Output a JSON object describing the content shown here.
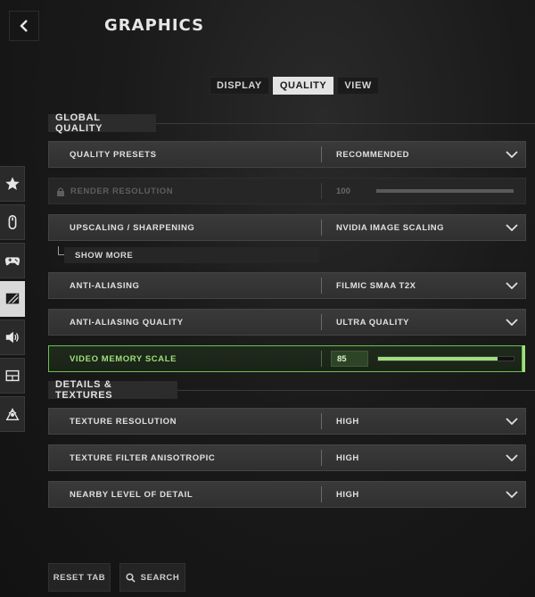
{
  "header": {
    "title": "GRAPHICS",
    "back_icon": "chevron-left-icon"
  },
  "tabs": [
    {
      "label": "DISPLAY",
      "active": false
    },
    {
      "label": "QUALITY",
      "active": true
    },
    {
      "label": "VIEW",
      "active": false
    }
  ],
  "side_nav": [
    {
      "icon": "star-icon",
      "active": false
    },
    {
      "icon": "mouse-icon",
      "active": false
    },
    {
      "icon": "gamepad-icon",
      "active": false
    },
    {
      "icon": "graphics-icon",
      "active": true
    },
    {
      "icon": "speaker-icon",
      "active": false
    },
    {
      "icon": "interface-icon",
      "active": false
    },
    {
      "icon": "network-icon",
      "active": false
    }
  ],
  "sections": {
    "global": "GLOBAL QUALITY",
    "details": "DETAILS & TEXTURES"
  },
  "settings": {
    "quality_presets": {
      "label": "QUALITY PRESETS",
      "value": "RECOMMENDED"
    },
    "render_resolution": {
      "label": "RENDER RESOLUTION",
      "value": "100",
      "disabled": true,
      "fill": 1.0
    },
    "upscaling": {
      "label": "UPSCALING / SHARPENING",
      "value": "NVIDIA IMAGE SCALING"
    },
    "show_more": "SHOW MORE",
    "anti_aliasing": {
      "label": "ANTI-ALIASING",
      "value": "FILMIC SMAA T2X"
    },
    "anti_aliasing_quality": {
      "label": "ANTI-ALIASING QUALITY",
      "value": "ULTRA QUALITY"
    },
    "video_memory_scale": {
      "label": "VIDEO MEMORY SCALE",
      "value": "85",
      "fill": 0.88
    },
    "texture_resolution": {
      "label": "TEXTURE RESOLUTION",
      "value": "HIGH"
    },
    "texture_filter": {
      "label": "TEXTURE FILTER ANISOTROPIC",
      "value": "HIGH"
    },
    "nearby_lod": {
      "label": "NEARBY LEVEL OF DETAIL",
      "value": "HIGH"
    }
  },
  "footer": {
    "reset": "RESET TAB",
    "search": "SEARCH",
    "search_icon": "search-icon"
  },
  "colors": {
    "accent_green": "#9fe07b",
    "highlight_border": "#6bbf4e"
  }
}
